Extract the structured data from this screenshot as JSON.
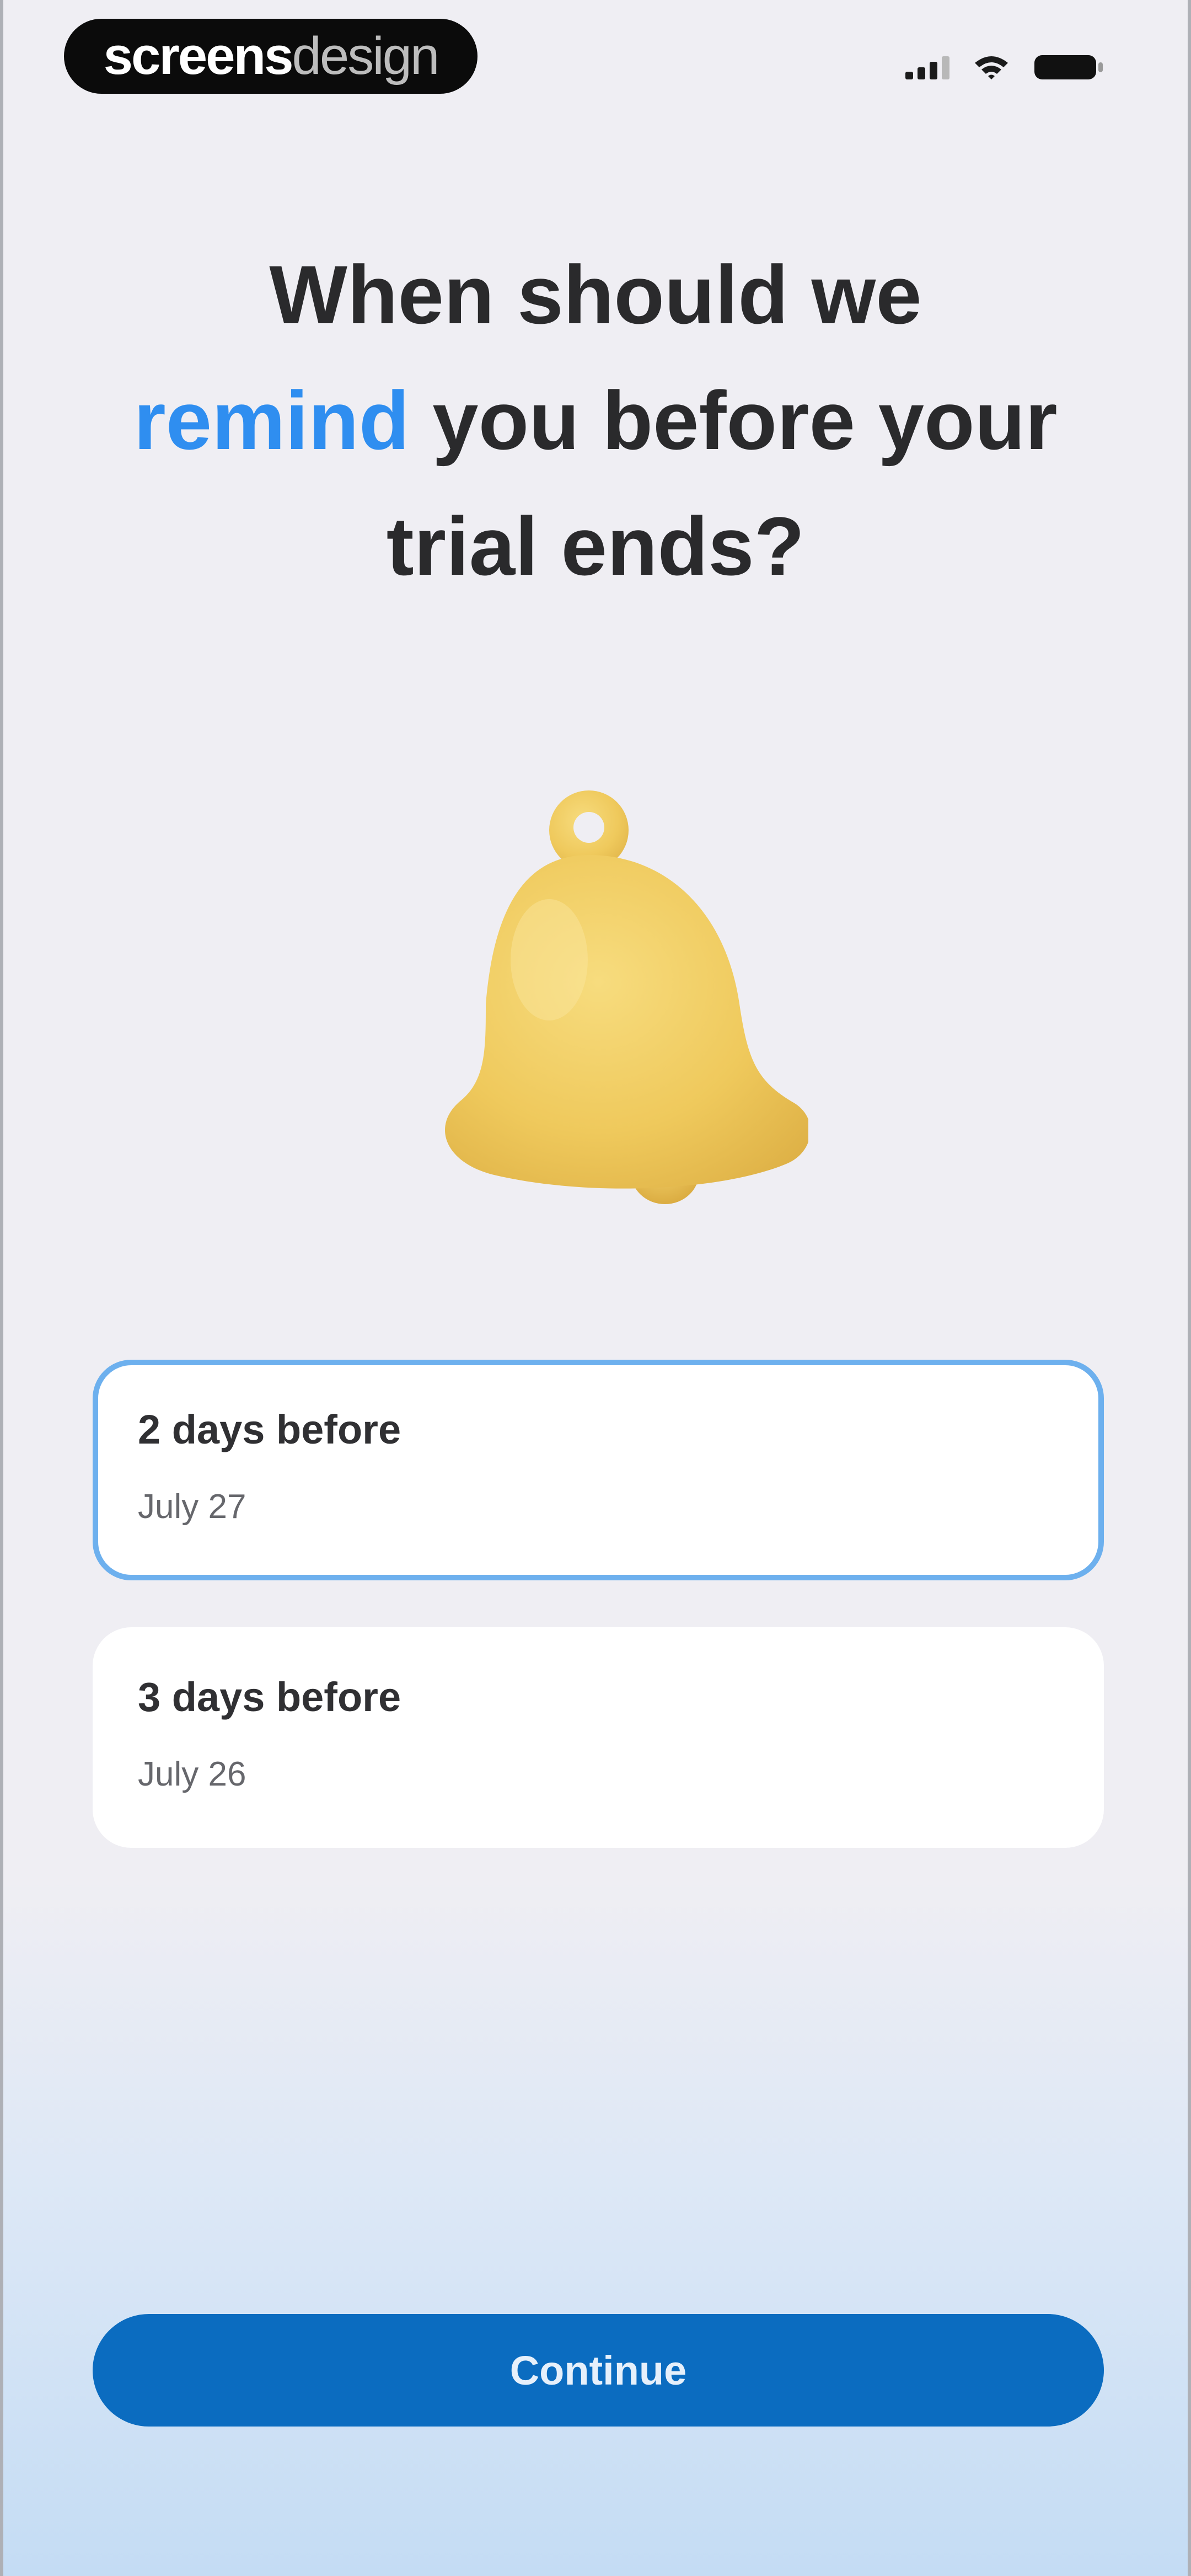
{
  "watermark": {
    "bold": "screens",
    "light": "design"
  },
  "status_bar": {
    "icons": [
      "signal-icon",
      "wifi-icon",
      "battery-icon"
    ]
  },
  "headline": {
    "line1": "When should we",
    "accent": "remind",
    "line2_rest": " you before your",
    "line3": "trial ends?"
  },
  "illustration": {
    "icon": "bell-icon"
  },
  "options": [
    {
      "title": "2 days before",
      "date": "July 27",
      "selected": true
    },
    {
      "title": "3 days before",
      "date": "July 26",
      "selected": false
    }
  ],
  "continue_label": "Continue",
  "colors": {
    "accent": "#2f8ef0",
    "button": "#0b6cc0",
    "selected_border": "#6db0ee",
    "bell": "#f0cc62",
    "background": "#efeef3"
  }
}
